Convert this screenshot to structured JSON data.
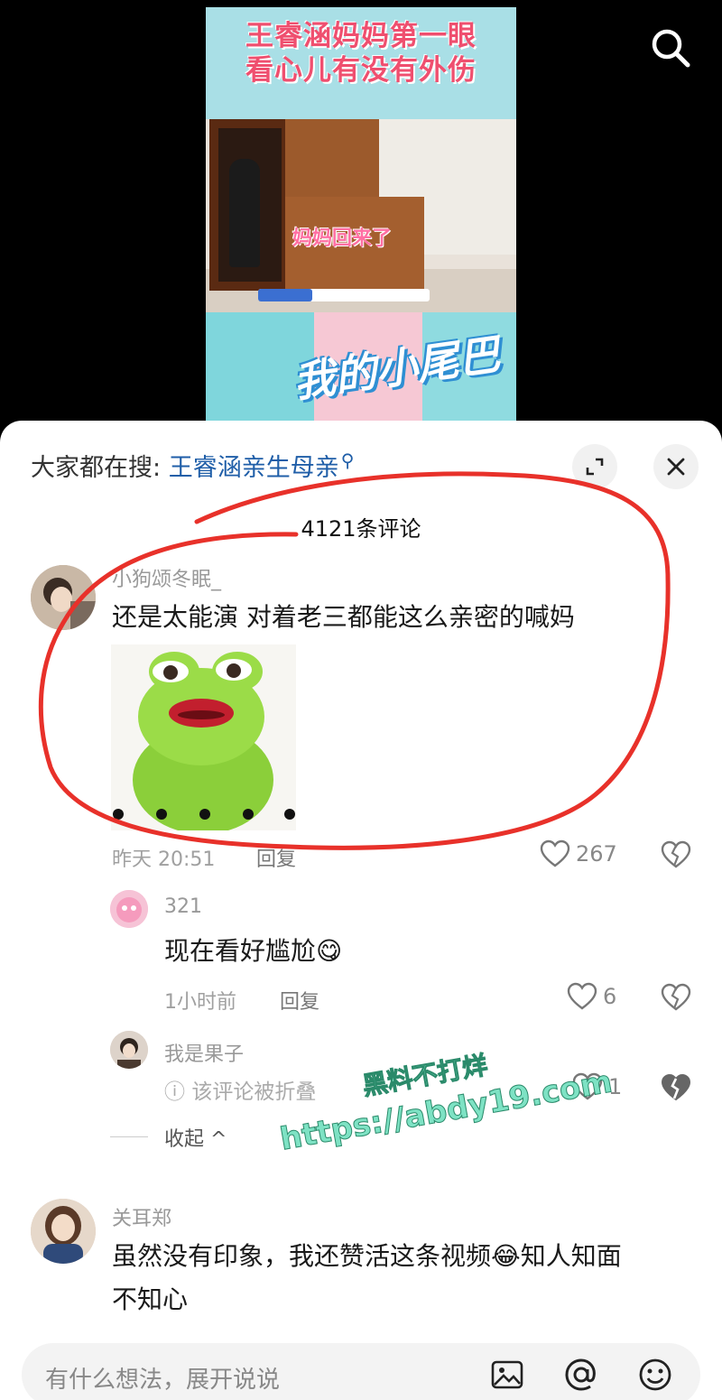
{
  "video": {
    "title_line1": "王睿涵妈妈第一眼",
    "title_line2": "看心儿有没有外伤",
    "scene_caption": "妈妈回来了",
    "show_logo": "我的小尾巴"
  },
  "search_bar": {
    "prefix": "大家都在搜:",
    "keyword": "王睿涵亲生母亲"
  },
  "comments_count": "4121条评论",
  "comments": [
    {
      "username": "小狗颂冬眠_",
      "text": "还是太能演 对着老三都能这么亲密的喊妈",
      "time": "昨天 20:51",
      "reply_label": "回复",
      "likes": "267",
      "replies": [
        {
          "username": "321",
          "text": "现在看好尴尬",
          "emoji": "😋",
          "time": "1小时前",
          "reply_label": "回复",
          "likes": "6"
        },
        {
          "username": "我是果子",
          "folded_text": "该评论被折叠",
          "likes": "1"
        }
      ],
      "collapse_label": "收起"
    },
    {
      "username": "关耳郑",
      "text_line1": "虽然没有印象，我还赞活这条视频",
      "emoji": "😂",
      "text_line1_end": "知人知面",
      "text_line2": "不知心"
    }
  ],
  "watermark": {
    "line1": "黑料不打烊",
    "line2": "https://abdy19.com"
  },
  "input": {
    "placeholder": "有什么想法，展开说说"
  },
  "colors": {
    "accent_link": "#1f5ea8",
    "annotation_red": "#e8312a",
    "watermark": "#7ee2c4"
  }
}
